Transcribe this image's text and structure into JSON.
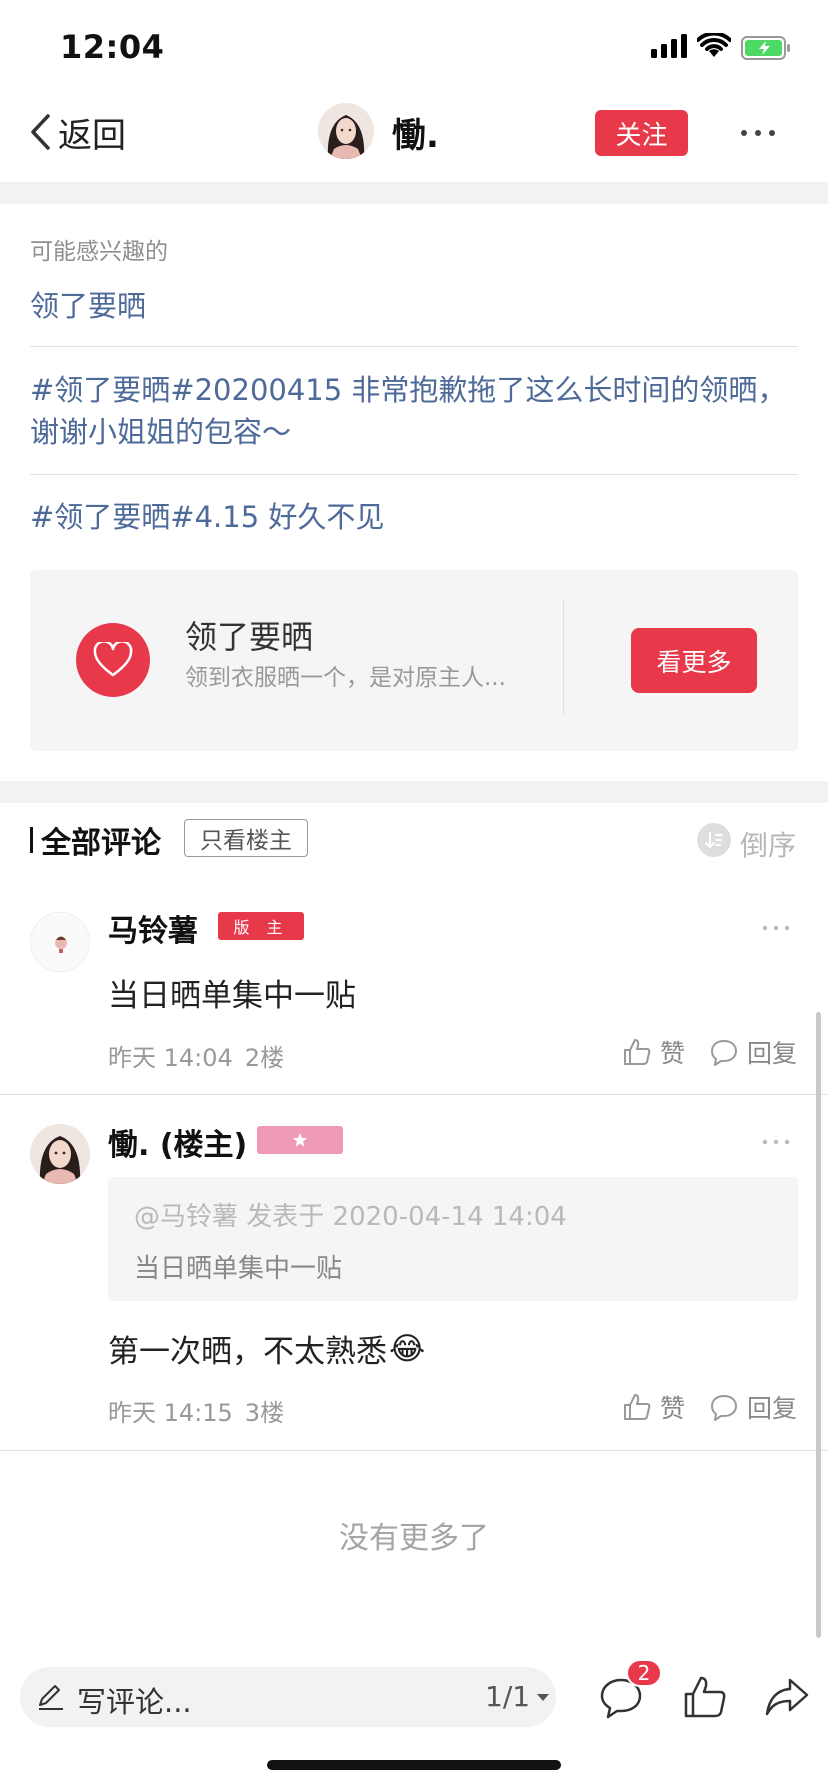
{
  "status_bar": {
    "time": "12:04"
  },
  "nav": {
    "back_label": "返回",
    "user_name": "慟.",
    "follow_label": "关注"
  },
  "interest": {
    "title": "可能感兴趣的",
    "links": [
      "领了要晒",
      "#领了要晒#20200415 非常抱歉拖了这么长时间的领晒，谢谢小姐姐的包容～",
      "#领了要晒#4.15 好久不见"
    ]
  },
  "topic_card": {
    "title": "领了要晒",
    "subtitle": "领到衣服晒一个，是对原主人...",
    "button_label": "看更多",
    "icon": "heart-icon"
  },
  "comments_header": {
    "title": "全部评论",
    "only_op_label": "只看楼主",
    "reverse_label": "倒序"
  },
  "comments": [
    {
      "name": "马铃薯",
      "badge": "版 主",
      "text": "当日晒单集中一贴",
      "time": "昨天 14:04",
      "floor": "2楼",
      "like_label": "赞",
      "reply_label": "回复"
    },
    {
      "name": "慟. (楼主)",
      "badge_icon": "star-icon",
      "quote_head": "@马铃薯 发表于 2020-04-14 14:04",
      "quote_body": "当日晒单集中一贴",
      "text": "第一次晒，不太熟悉",
      "emoji": "😂",
      "time": "昨天 14:15",
      "floor": "3楼",
      "like_label": "赞",
      "reply_label": "回复"
    }
  ],
  "no_more": "没有更多了",
  "bottom_bar": {
    "placeholder": "写评论...",
    "page": "1/1",
    "comment_count": "2"
  },
  "colors": {
    "accent": "#e8394b",
    "link": "#4e6a99",
    "badge_star": "#f09aba"
  }
}
